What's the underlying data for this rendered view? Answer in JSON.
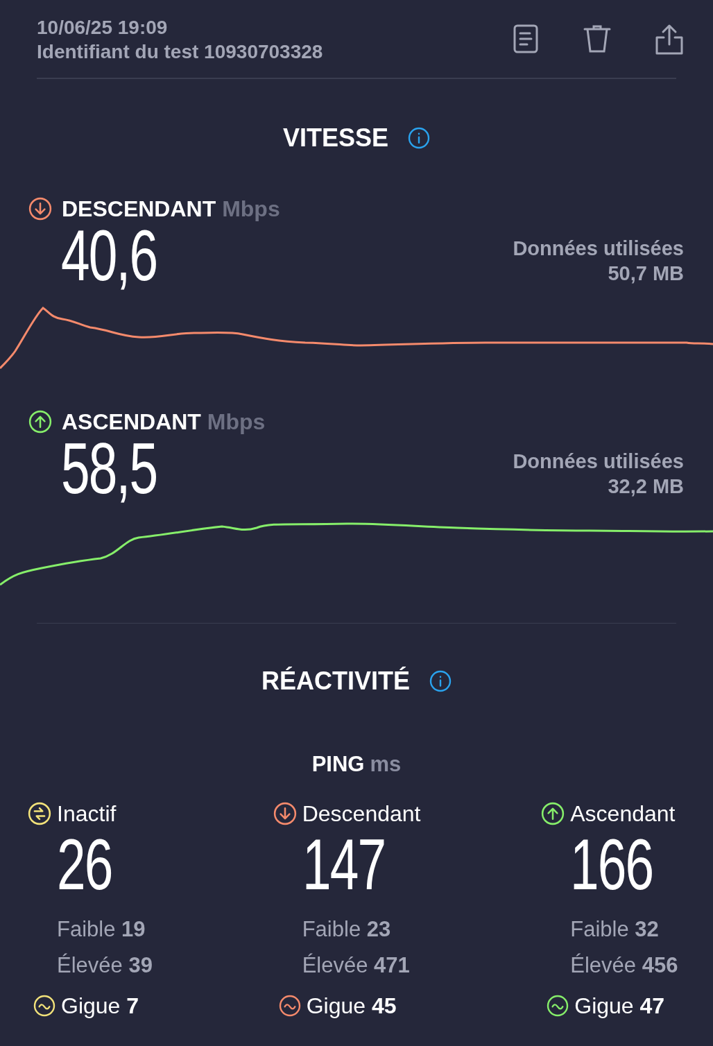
{
  "header": {
    "date": "10/06/25 19:09",
    "test_id": "Identifiant du test 10930703328"
  },
  "speed": {
    "title": "VITESSE",
    "directions": [
      {
        "kind": "download",
        "label": "DESCENDANT",
        "unit": "Mbps",
        "value": "40,6",
        "data_label": "Données utilisées",
        "data_value": "50,7 MB"
      },
      {
        "kind": "upload",
        "label": "ASCENDANT",
        "unit": "Mbps",
        "value": "58,5",
        "data_label": "Données utilisées",
        "data_value": "32,2 MB"
      }
    ]
  },
  "responsiveness": {
    "title": "RÉACTIVITÉ",
    "ping_label": "PING",
    "ping_unit": "ms",
    "columns": [
      {
        "kind": "idle",
        "label": "Inactif",
        "value": "26",
        "low": "Faible **19**",
        "high": "Élevée **39**",
        "jitter": "Gigue **7**"
      },
      {
        "kind": "download",
        "label": "Descendant",
        "value": "147",
        "low": "Faible **23**",
        "high": "Élevée **471**",
        "jitter": "Gigue **45**"
      },
      {
        "kind": "upload",
        "label": "Ascendant",
        "value": "166",
        "low": "Faible **32**",
        "high": "Élevée **456**",
        "jitter": "Gigue **47**"
      }
    ]
  }
}
